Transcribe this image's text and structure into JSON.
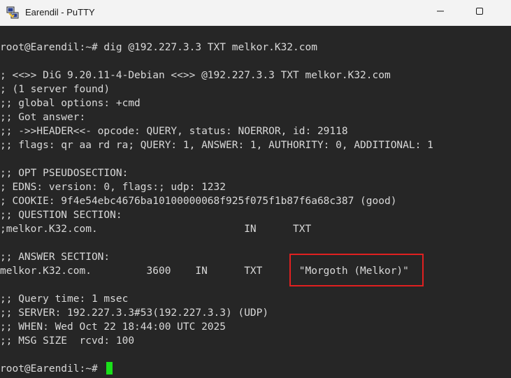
{
  "window": {
    "title": "Earendil - PuTTY",
    "icon": "putty-icon",
    "minimize_icon": "minimize-icon",
    "maximize_icon": "maximize-icon",
    "accent_colors": {
      "terminal_bg": "#262626",
      "terminal_fg": "#d9d9d9",
      "cursor": "#1ae01a",
      "highlight": "#e02020"
    }
  },
  "terminal": {
    "lines": [
      "root@Earendil:~# dig @192.227.3.3 TXT melkor.K32.com",
      "",
      "; <<>> DiG 9.20.11-4-Debian <<>> @192.227.3.3 TXT melkor.K32.com",
      "; (1 server found)",
      ";; global options: +cmd",
      ";; Got answer:",
      ";; ->>HEADER<<- opcode: QUERY, status: NOERROR, id: 29118",
      ";; flags: qr aa rd ra; QUERY: 1, ANSWER: 1, AUTHORITY: 0, ADDITIONAL: 1",
      "",
      ";; OPT PSEUDOSECTION:",
      "; EDNS: version: 0, flags:; udp: 1232",
      "; COOKIE: 9f4e54ebc4676ba10100000068f925f075f1b87f6a68c387 (good)",
      ";; QUESTION SECTION:",
      ";melkor.K32.com.                        IN      TXT",
      "",
      ";; ANSWER SECTION:",
      "melkor.K32.com.         3600    IN      TXT      \"Morgoth (Melkor)\"",
      "",
      ";; Query time: 1 msec",
      ";; SERVER: 192.227.3.3#53(192.227.3.3) (UDP)",
      ";; WHEN: Wed Oct 22 18:44:00 UTC 2025",
      ";; MSG SIZE  rcvd: 100",
      "",
      "root@Earendil:~# "
    ]
  }
}
